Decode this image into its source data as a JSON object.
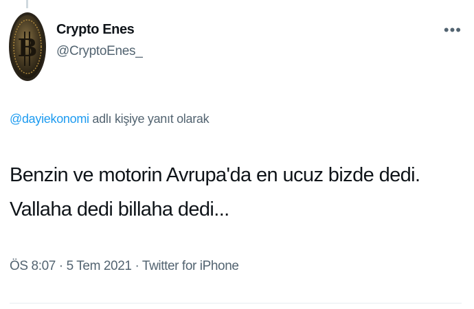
{
  "tweet": {
    "author": {
      "display_name": "Crypto Enes",
      "handle": "@CryptoEnes_",
      "avatar_icon": "bitcoin-coin-icon"
    },
    "more_label": "•••",
    "reply_context": {
      "mention": "@dayiekonomi",
      "suffix": " adlı kişiye yanıt olarak"
    },
    "text_lines": [
      "Benzin ve motorin Avrupa'da en ucuz bizde dedi.",
      "Vallaha dedi billaha dedi..."
    ],
    "meta": {
      "time": "ÖS 8:07",
      "sep1": " · ",
      "date": "5 Tem 2021",
      "sep2": " · ",
      "source": "Twitter for iPhone"
    }
  },
  "colors": {
    "text": "#0f1419",
    "secondary": "#536471",
    "link": "#1d9bf0",
    "coin_gold": "#b08a3e",
    "coin_dark": "#2a241a"
  }
}
